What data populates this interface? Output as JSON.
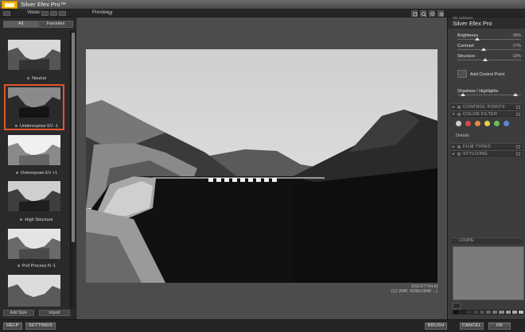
{
  "window": {
    "title": "Silver Efex Pro™"
  },
  "toolbar": {
    "views_label": "Views:",
    "preview_label": "Preview:"
  },
  "left_panel": {
    "tabs": [
      "All",
      "Favorites"
    ],
    "presets": [
      {
        "label": "Neutral",
        "selected": false
      },
      {
        "label": "Underexpose EV -1",
        "selected": true
      },
      {
        "label": "Overexpose EV +1",
        "selected": false
      },
      {
        "label": "High Structure",
        "selected": false
      },
      {
        "label": "Pull Process N -1",
        "selected": false
      },
      {
        "label": "",
        "selected": false
      }
    ],
    "add_style_label": "Add Style",
    "import_label": "Import"
  },
  "preview": {
    "filename": "DSC07794.tif",
    "fileinfo": "(12.2MP, 4288x2848 ...)"
  },
  "right_panel": {
    "brand": "Nik Software",
    "title": "Silver Efex Pro",
    "sliders": [
      {
        "label": "Brightness",
        "value": "-35%"
      },
      {
        "label": "Contrast",
        "value": "-17%"
      },
      {
        "label": "Structure",
        "value": "-10%"
      }
    ],
    "add_control_point": "Add Control Point",
    "shadows_highlights": "Shadows / Highlights",
    "sections": [
      "CONTROL POINTS",
      "COLOR FILTER",
      "FILM TYPES",
      "STYLIZING"
    ],
    "details_label": "Details",
    "loupe_label": "LOUPE",
    "filter_colors": [
      "#cfcfcf",
      "#d94848",
      "#e08a3a",
      "#e6d24a",
      "#6cbf5a",
      "#5a86d6"
    ]
  },
  "bottom_bar": {
    "help": "HELP",
    "settings": "SETTINGS",
    "brush": "BRUSH",
    "cancel": "CANCEL",
    "ok": "OK"
  }
}
